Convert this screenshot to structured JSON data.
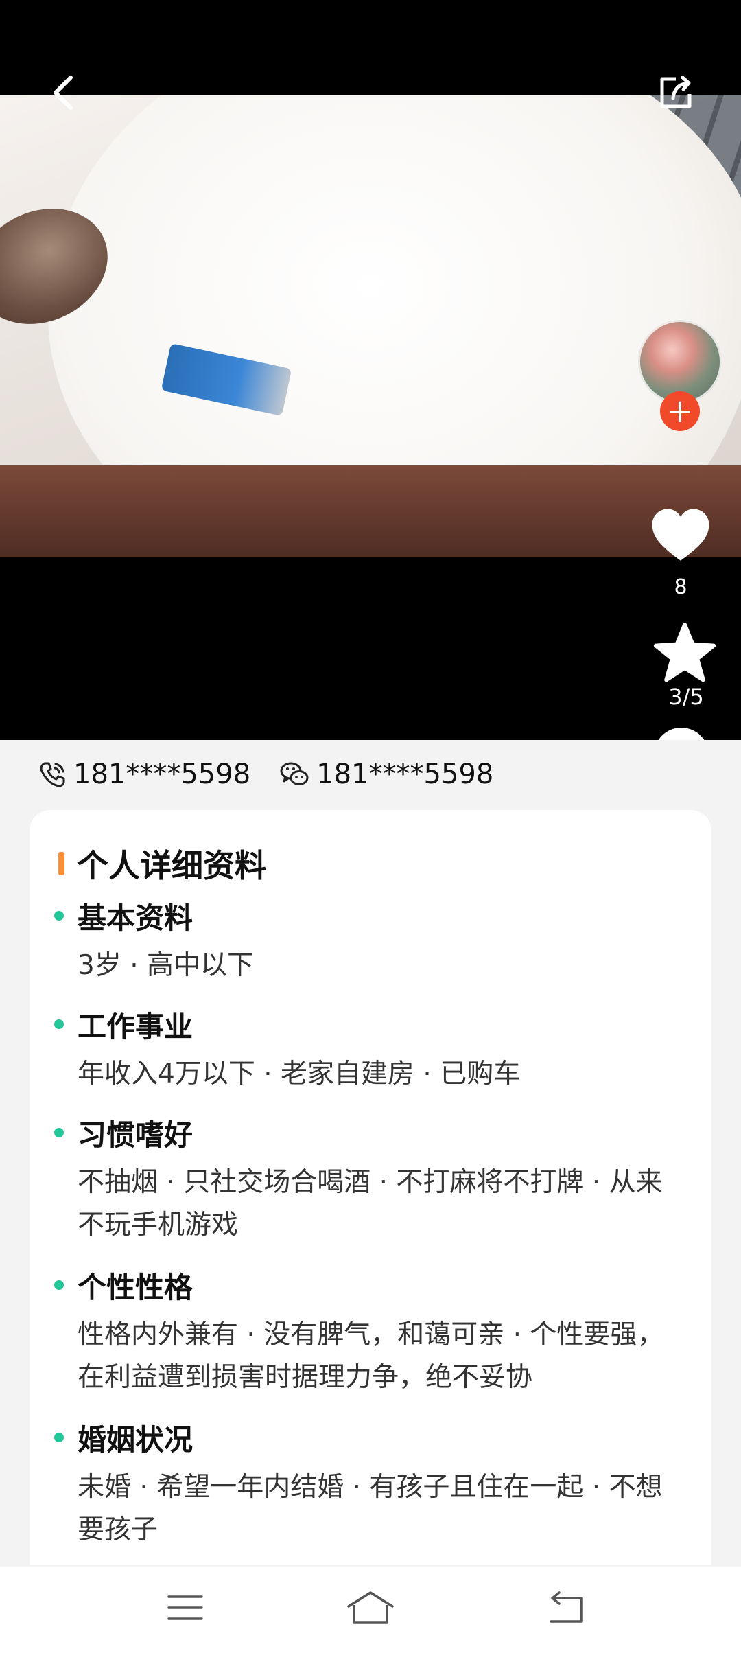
{
  "header": {
    "back_icon": "chevron-left-icon",
    "share_icon": "share-icon"
  },
  "side_actions": {
    "like_count": "8",
    "page_indicator": "3/5",
    "follow_icon": "plus-icon"
  },
  "contact": {
    "phone": "181****5598",
    "wechat": "181****5598"
  },
  "profile": {
    "title": "个人详细资料",
    "sections": [
      {
        "heading": "基本资料",
        "text": "3岁 · 高中以下"
      },
      {
        "heading": "工作事业",
        "text": "年收入4万以下 · 老家自建房 · 已购车"
      },
      {
        "heading": "习惯嗜好",
        "text": "不抽烟 · 只社交场合喝酒 · 不打麻将不打牌 · 从来不玩手机游戏"
      },
      {
        "heading": "个性性格",
        "text": "性格内外兼有 · 没有脾气，和蔼可亲 · 个性要强，在利益遭到损害时据理力争，绝不妥协"
      },
      {
        "heading": "婚姻状况",
        "text": "未婚 · 希望一年内结婚 · 有孩子且住在一起 · 不想要孩子"
      }
    ]
  },
  "colors": {
    "accent_orange": "#ff8d3a",
    "bullet_green": "#23c89a",
    "follow_red": "#f04a2a"
  },
  "navbar": {
    "menu_icon": "menu-icon",
    "home_icon": "home-icon",
    "back_icon": "back-icon"
  }
}
